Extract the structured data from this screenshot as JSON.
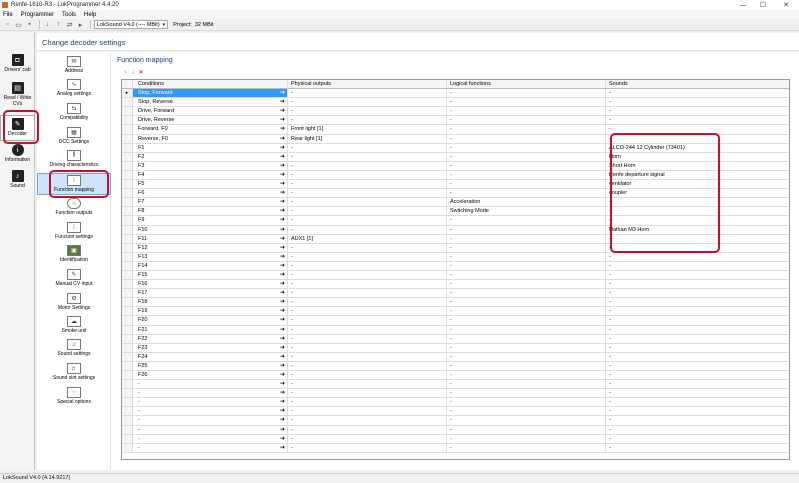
{
  "window": {
    "title": "Renfe-1610-R3 - LokProgrammer 4.4.20",
    "controls": [
      "—",
      "☐",
      "✕"
    ]
  },
  "menu": {
    "items": [
      "File",
      "Programmer",
      "Tools",
      "Help"
    ]
  },
  "toolbar": {
    "decoder_combo": "LokSound V4.0 (---- MBit)",
    "project_label": "Project:",
    "project_size": "32 MBit"
  },
  "left_nav": {
    "items": [
      {
        "label": "Drivers' cab",
        "icon": "cab-icon"
      },
      {
        "label": "Read / Write CVs",
        "icon": "read-write-icon"
      },
      {
        "label": "Decoder",
        "icon": "decoder-icon"
      },
      {
        "label": "Information",
        "icon": "info-icon"
      },
      {
        "label": "Sound",
        "icon": "sound-icon"
      }
    ],
    "selected": "Decoder"
  },
  "header": {
    "title": "Change decoder settings"
  },
  "sub_nav": {
    "items": [
      {
        "label": "Address",
        "icon": "envelope-icon"
      },
      {
        "label": "Analog settings",
        "icon": "analog-icon"
      },
      {
        "label": "Compatibility",
        "icon": "compatibility-icon"
      },
      {
        "label": "DCC Settings",
        "icon": "dcc-icon"
      },
      {
        "label": "Driving characteristics",
        "icon": "sliders-icon"
      },
      {
        "label": "Function mapping",
        "icon": "function-mapping-icon"
      },
      {
        "label": "Function outputs",
        "icon": "lightbulb-icon"
      },
      {
        "label": "Function settings",
        "icon": "function-settings-icon"
      },
      {
        "label": "Identification",
        "icon": "chip-icon"
      },
      {
        "label": "Manual CV input",
        "icon": "pen-icon"
      },
      {
        "label": "Motor Settings",
        "icon": "motor-icon"
      },
      {
        "label": "Smoke unit",
        "icon": "smoke-icon"
      },
      {
        "label": "Sound settings",
        "icon": "sound-settings-icon"
      },
      {
        "label": "Sound slot settings",
        "icon": "sound-slot-icon"
      },
      {
        "label": "Special options",
        "icon": "special-options-icon"
      }
    ],
    "selected": "Function mapping"
  },
  "content": {
    "title": "Function mapping",
    "toolbar_icons": [
      "move-up-icon",
      "move-down-icon",
      "delete-icon"
    ],
    "columns": [
      "Conditions",
      "Physical outputs",
      "Logical functions",
      "Sounds"
    ],
    "rows": [
      {
        "cond": "Stop, Forward",
        "phys": "-",
        "log": "-",
        "snd": "-"
      },
      {
        "cond": "Stop, Reverse",
        "phys": "-",
        "log": "-",
        "snd": "-"
      },
      {
        "cond": "Drive, Forward",
        "phys": "-",
        "log": "-",
        "snd": "-"
      },
      {
        "cond": "Drive, Reverse",
        "phys": "-",
        "log": "-",
        "snd": "-"
      },
      {
        "cond": "Forward, F0",
        "phys": "Front light [1]",
        "log": "-",
        "snd": "-"
      },
      {
        "cond": "Reverse, F0",
        "phys": "Rear light [1]",
        "log": "-",
        "snd": "-"
      },
      {
        "cond": "F1",
        "phys": "-",
        "log": "-",
        "snd": "ALCO-244 12 Cylinder (73401)"
      },
      {
        "cond": "F2",
        "phys": "-",
        "log": "-",
        "snd": "Horn"
      },
      {
        "cond": "F3",
        "phys": "-",
        "log": "-",
        "snd": "Short Horn"
      },
      {
        "cond": "F4",
        "phys": "-",
        "log": "-",
        "snd": "Renfe departure signal"
      },
      {
        "cond": "F5",
        "phys": "-",
        "log": "-",
        "snd": "ventilator"
      },
      {
        "cond": "F6",
        "phys": "-",
        "log": "-",
        "snd": "coupler"
      },
      {
        "cond": "F7",
        "phys": "-",
        "log": "Acceleration",
        "snd": "-"
      },
      {
        "cond": "F8",
        "phys": "-",
        "log": "Switching Mode",
        "snd": "-"
      },
      {
        "cond": "F9",
        "phys": "-",
        "log": "-",
        "snd": "-"
      },
      {
        "cond": "F10",
        "phys": "-",
        "log": "-",
        "snd": "Nathan M3 Horn"
      },
      {
        "cond": "F11",
        "phys": "AUX1 [1]",
        "log": "-",
        "snd": "-"
      },
      {
        "cond": "F12",
        "phys": "-",
        "log": "-",
        "snd": "-"
      },
      {
        "cond": "F13",
        "phys": "-",
        "log": "-",
        "snd": "-"
      },
      {
        "cond": "F14",
        "phys": "-",
        "log": "-",
        "snd": "-"
      },
      {
        "cond": "F15",
        "phys": "-",
        "log": "-",
        "snd": "-"
      },
      {
        "cond": "F16",
        "phys": "-",
        "log": "-",
        "snd": "-"
      },
      {
        "cond": "F17",
        "phys": "-",
        "log": "-",
        "snd": "-"
      },
      {
        "cond": "F18",
        "phys": "-",
        "log": "-",
        "snd": "-"
      },
      {
        "cond": "F19",
        "phys": "-",
        "log": "-",
        "snd": "-"
      },
      {
        "cond": "F20",
        "phys": "-",
        "log": "-",
        "snd": "-"
      },
      {
        "cond": "F21",
        "phys": "-",
        "log": "-",
        "snd": "-"
      },
      {
        "cond": "F22",
        "phys": "-",
        "log": "-",
        "snd": "-"
      },
      {
        "cond": "F23",
        "phys": "-",
        "log": "-",
        "snd": "-"
      },
      {
        "cond": "F24",
        "phys": "-",
        "log": "-",
        "snd": "-"
      },
      {
        "cond": "F25",
        "phys": "-",
        "log": "-",
        "snd": "-"
      },
      {
        "cond": "F26",
        "phys": "-",
        "log": "-",
        "snd": "-"
      },
      {
        "cond": "-",
        "phys": "-",
        "log": "-",
        "snd": "-"
      },
      {
        "cond": "-",
        "phys": "-",
        "log": "-",
        "snd": "-"
      },
      {
        "cond": "-",
        "phys": "-",
        "log": "-",
        "snd": "-"
      },
      {
        "cond": "-",
        "phys": "-",
        "log": "-",
        "snd": "-"
      },
      {
        "cond": "-",
        "phys": "-",
        "log": "-",
        "snd": "-"
      },
      {
        "cond": "-",
        "phys": "-",
        "log": "-",
        "snd": "-"
      },
      {
        "cond": "-",
        "phys": "-",
        "log": "-",
        "snd": "-"
      },
      {
        "cond": "-",
        "phys": "-",
        "log": "-",
        "snd": "-"
      }
    ],
    "selected_row": 0,
    "row_arrow": "➔"
  },
  "status": {
    "text": "LokSound V4.0 (4.14.9217)"
  },
  "accent_colors": {
    "selection": "#3399ff",
    "highlight_box": "#c8102e",
    "header_text": "#1e3f7a"
  }
}
